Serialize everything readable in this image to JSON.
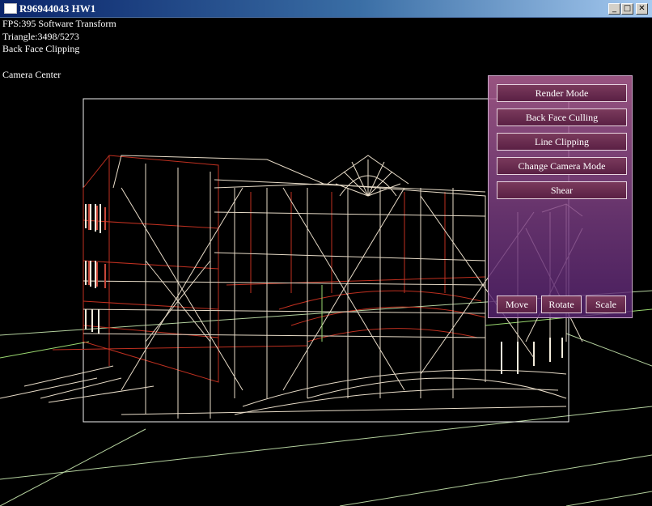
{
  "window": {
    "title": "R96944043 HW1",
    "minimize_glyph": "_",
    "maximize_glyph": "□",
    "close_glyph": "✕"
  },
  "hud": {
    "fps": "FPS:395 Software Transform",
    "triangles": "Triangle:3498/5273",
    "clipping": "Back Face Clipping",
    "camera": "Camera Center"
  },
  "panel": {
    "buttons": [
      "Render Mode",
      "Back Face Culling",
      "Line Clipping",
      "Change Camera Mode",
      "Shear"
    ],
    "transform_buttons": [
      "Move",
      "Rotate",
      "Scale"
    ]
  },
  "colors": {
    "background": "#000000",
    "wire_light": "#e8dcc8",
    "wire_red": "#c03020",
    "wire_green": "#9ad870",
    "panel_top": "#b26296",
    "panel_bottom": "#55236e"
  }
}
